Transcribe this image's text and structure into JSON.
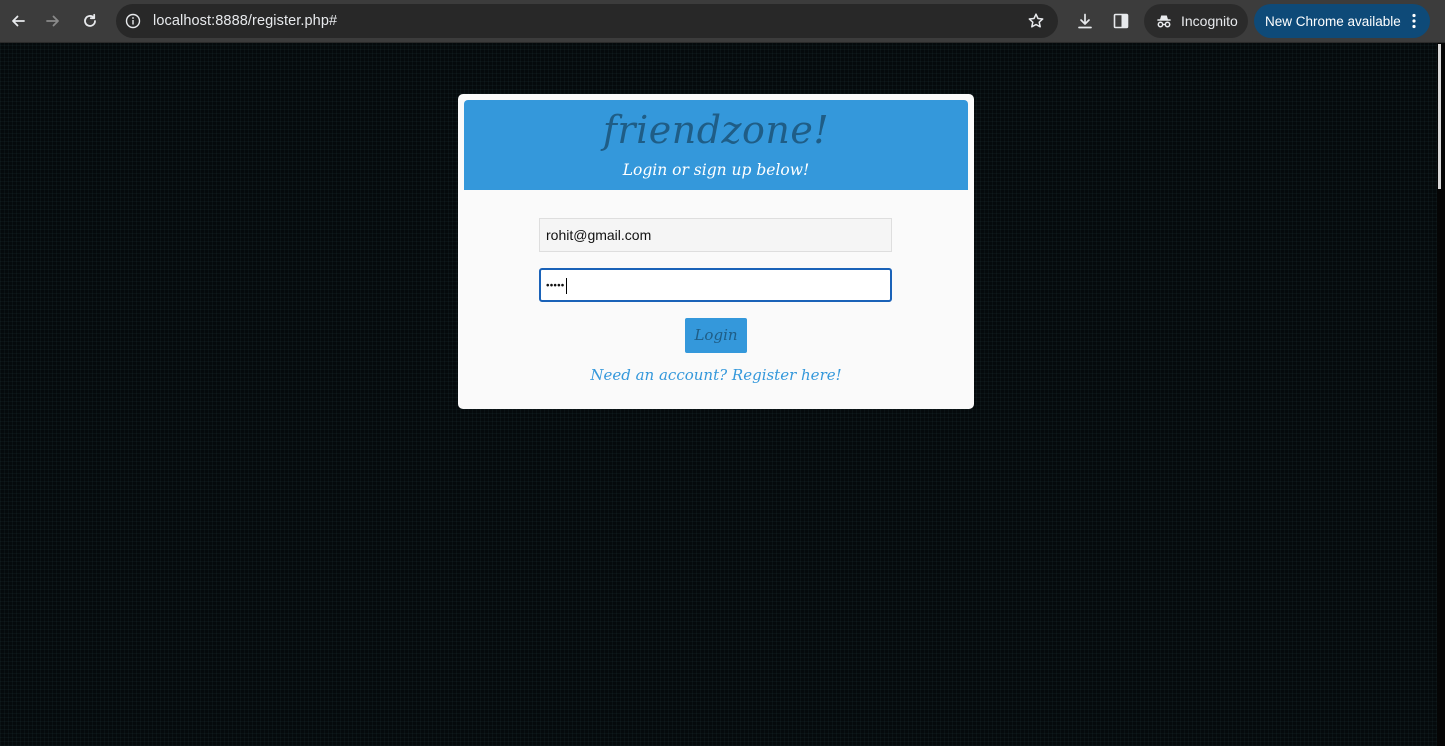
{
  "browser": {
    "url": "localhost:8888/register.php#",
    "incognito_label": "Incognito",
    "update_label": "New Chrome available",
    "icons": {
      "back": "back-arrow-icon",
      "forward": "forward-arrow-icon",
      "reload": "reload-icon",
      "site_info": "info-icon",
      "bookmark": "star-icon",
      "downloads": "download-icon",
      "side_panel": "side-panel-icon",
      "incognito": "incognito-icon",
      "menu": "vertical-dots-icon"
    }
  },
  "card": {
    "brand": "friendzone!",
    "tagline": "Login or sign up below!",
    "email_value": "rohit@gmail.com",
    "password_value": "•••••",
    "login_label": "Login",
    "register_link": "Need an account? Register here!"
  },
  "colors": {
    "header_blue": "#3498db",
    "brand_text": "#1f5d86",
    "focus_border": "#1a62b8",
    "update_button": "#0e4a78"
  }
}
